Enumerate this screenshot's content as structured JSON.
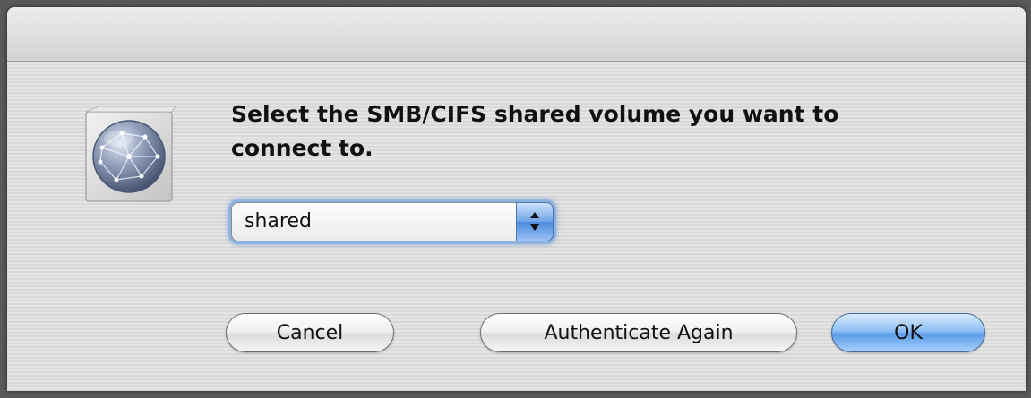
{
  "dialog": {
    "message": "Select the SMB/CIFS shared volume you want to connect to.",
    "volume_select": {
      "selected_value": "shared"
    },
    "buttons": {
      "cancel": "Cancel",
      "authenticate_again": "Authenticate Again",
      "ok": "OK"
    },
    "icon": "network-globe-icon",
    "colors": {
      "default_button": "#5b9de9",
      "focus_ring": "#8fb3e0"
    }
  }
}
